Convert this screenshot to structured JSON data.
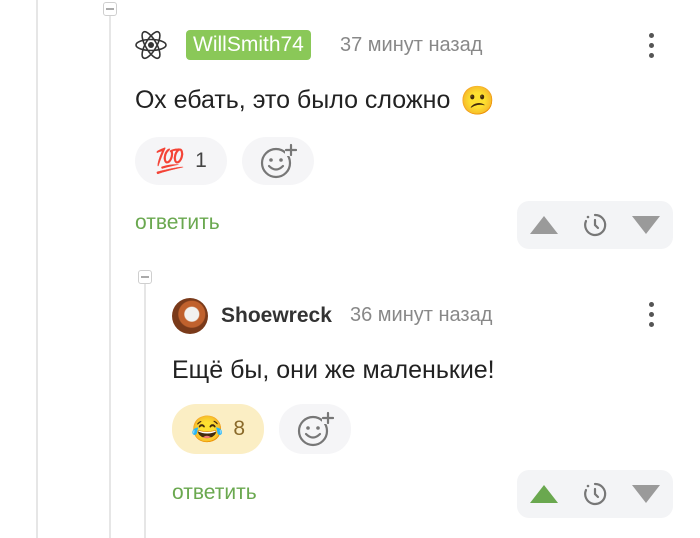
{
  "comments": [
    {
      "author": "WillSmith74",
      "time": "37 минут назад",
      "text": "Ох ебать, это было сложно",
      "text_emoji": "😕",
      "reaction": {
        "emoji": "💯",
        "count": "1"
      },
      "reply_label": "ответить"
    },
    {
      "author": "Shoewreck",
      "time": "36 минут назад",
      "text": "Ещё бы, они же маленькие!",
      "reaction": {
        "emoji": "😂",
        "count": "8"
      },
      "reply_label": "ответить"
    }
  ],
  "colors": {
    "author_badge": "#8ac858",
    "reply": "#6aa84f",
    "upvote_active": "#6aa84f",
    "vote_inactive": "#9a9a9a"
  }
}
